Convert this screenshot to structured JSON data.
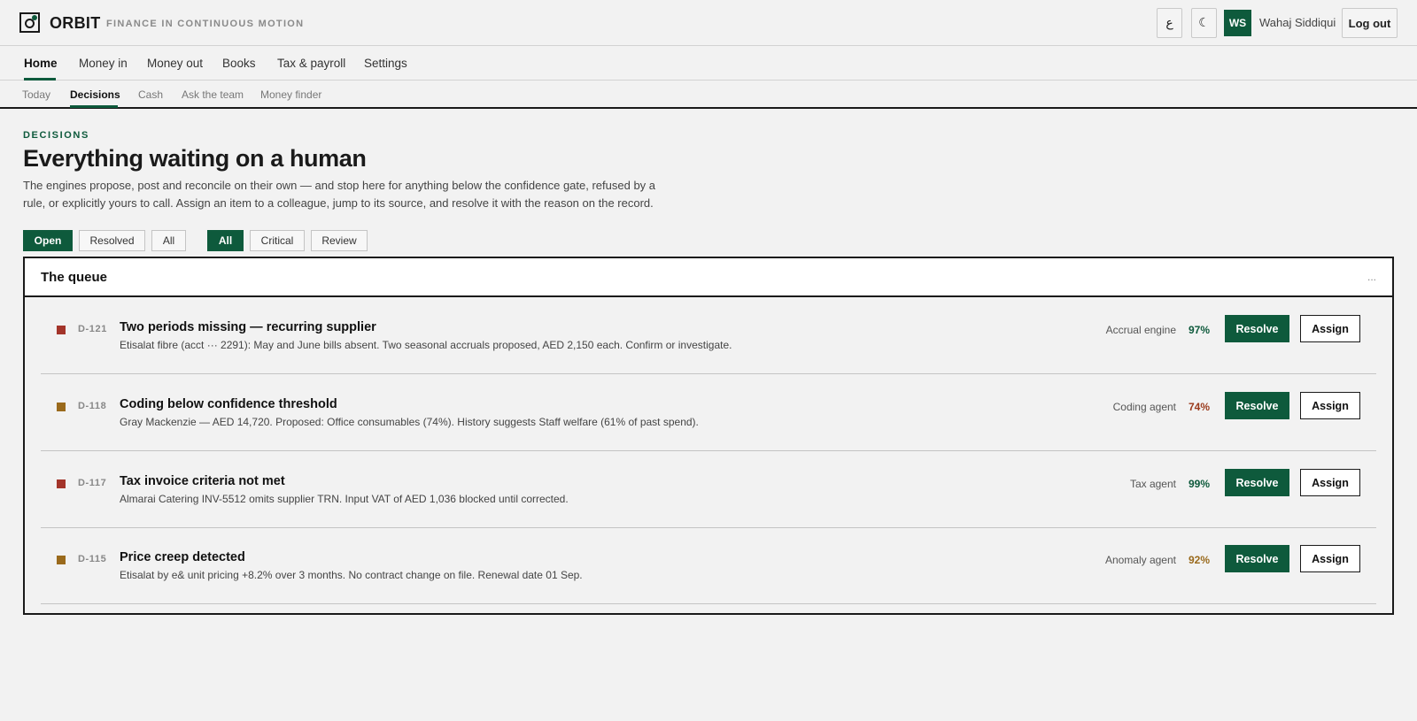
{
  "brand": {
    "name": "ORBIT",
    "tagline": "FINANCE IN CONTINUOUS MOTION"
  },
  "header": {
    "language_button": "ع",
    "theme_button": "☾",
    "avatar_initials": "WS",
    "user_name": "Wahaj Siddiqui",
    "logout_label": "Log out"
  },
  "primary_nav": [
    {
      "label": "Home"
    },
    {
      "label": "Money in"
    },
    {
      "label": "Money out"
    },
    {
      "label": "Books"
    },
    {
      "label": "Tax & payroll"
    },
    {
      "label": "Settings"
    }
  ],
  "sub_nav": [
    {
      "label": "Today"
    },
    {
      "label": "Decisions"
    },
    {
      "label": "Cash"
    },
    {
      "label": "Ask the team"
    },
    {
      "label": "Money finder"
    }
  ],
  "page": {
    "eyebrow": "DECISIONS",
    "title": "Everything waiting on a human",
    "description": "The engines propose, post and reconcile on their own — and stop here for anything below the confidence gate, refused by a rule, or explicitly yours to call. Assign an item to a colleague, jump to its source, and resolve it with the reason on the record."
  },
  "filters": {
    "status": [
      {
        "label": "Open"
      },
      {
        "label": "Resolved"
      },
      {
        "label": "All"
      }
    ],
    "severity": [
      {
        "label": "All"
      },
      {
        "label": "Critical"
      },
      {
        "label": "Review"
      }
    ]
  },
  "queue": {
    "title": "The queue",
    "more": "...",
    "resolve_label": "Resolve",
    "assign_label": "Assign",
    "items": [
      {
        "id": "D-121",
        "title": "Two periods missing — recurring supplier",
        "description": "Etisalat fibre (acct ··· 2291): May and June bills absent. Two seasonal accruals proposed, AED 2,150 each. Confirm or investigate.",
        "agent": "Accrual engine",
        "confidence": "97%",
        "severity_color": "#a3342a",
        "confidence_color": "#0e5a3c"
      },
      {
        "id": "D-118",
        "title": "Coding below confidence threshold",
        "description": "Gray Mackenzie — AED 14,720. Proposed: Office consumables (74%). History suggests Staff welfare (61% of past spend).",
        "agent": "Coding agent",
        "confidence": "74%",
        "severity_color": "#9a6a1c",
        "confidence_color": "#9a3a1c"
      },
      {
        "id": "D-117",
        "title": "Tax invoice criteria not met",
        "description": "Almarai Catering INV-5512 omits supplier TRN. Input VAT of AED 1,036 blocked until corrected.",
        "agent": "Tax agent",
        "confidence": "99%",
        "severity_color": "#a3342a",
        "confidence_color": "#0e5a3c"
      },
      {
        "id": "D-115",
        "title": "Price creep detected",
        "description": "Etisalat by e& unit pricing +8.2% over 3 months. No contract change on file. Renewal date 01 Sep.",
        "agent": "Anomaly agent",
        "confidence": "92%",
        "severity_color": "#9a6a1c",
        "confidence_color": "#9a6a1c"
      }
    ]
  }
}
